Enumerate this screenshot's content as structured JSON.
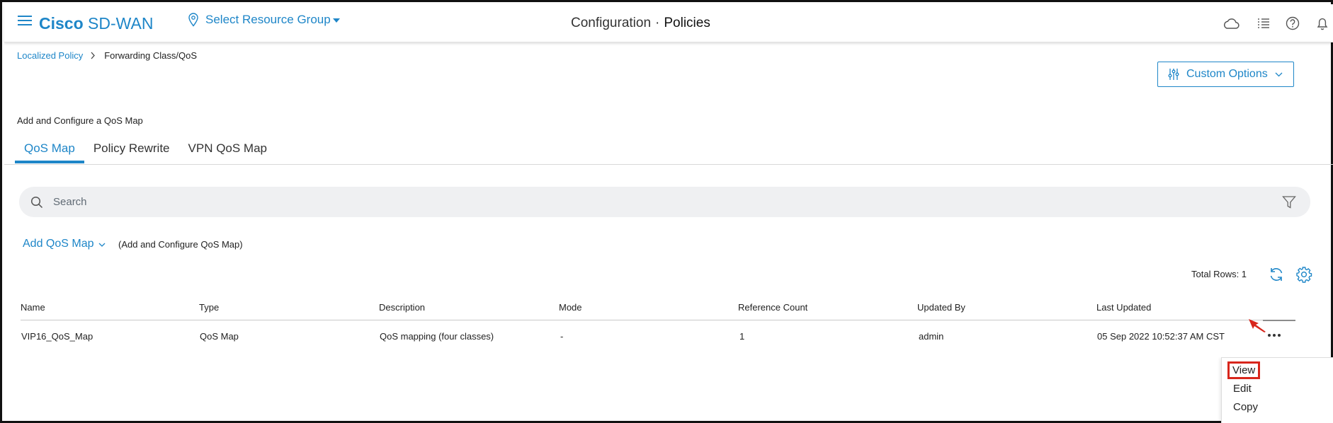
{
  "header": {
    "brand_bold": "Cisco",
    "brand_rest": "SD-WAN",
    "resource_group": "Select Resource Group",
    "title_left": "Configuration",
    "title_sep": "·",
    "title_right": "Policies",
    "icons": [
      "hamburger-icon",
      "location-pin-icon",
      "cloud-icon",
      "task-list-icon",
      "help-icon",
      "bell-icon"
    ]
  },
  "breadcrumb": {
    "parent": "Localized Policy",
    "current": "Forwarding Class/QoS"
  },
  "custom_options": "Custom Options",
  "section_label": "Add and Configure a QoS Map",
  "tabs": [
    {
      "label": "QoS Map",
      "active": true
    },
    {
      "label": "Policy Rewrite",
      "active": false
    },
    {
      "label": "VPN QoS Map",
      "active": false
    }
  ],
  "search": {
    "placeholder": "Search"
  },
  "add": {
    "label": "Add QoS Map",
    "description": "(Add and Configure QoS Map)"
  },
  "table": {
    "total_rows": "Total Rows: 1",
    "columns": [
      "Name",
      "Type",
      "Description",
      "Mode",
      "Reference Count",
      "Updated By",
      "Last Updated"
    ],
    "rows": [
      [
        "VIP16_QoS_Map",
        "QoS Map",
        "QoS mapping (four classes)",
        "-",
        "1",
        "admin",
        "05 Sep 2022 10:52:37 AM CST"
      ]
    ]
  },
  "row_menu": [
    "View",
    "Edit",
    "Copy"
  ],
  "colors": {
    "accent": "#1e86c8",
    "highlight": "#d8261c"
  }
}
